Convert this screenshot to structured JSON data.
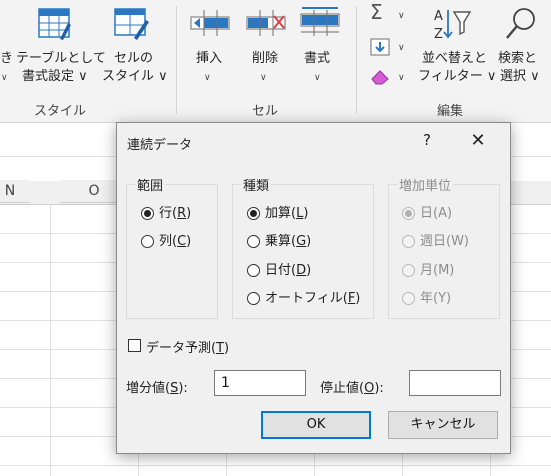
{
  "ribbon": {
    "style_group": {
      "partial_label_1": "き",
      "partial_label_2": "∨",
      "table_format_label_1": "テーブルとして",
      "table_format_label_2": "書式設定 ∨",
      "cell_style_label_1": "セルの",
      "cell_style_label_2": "スタイル ∨",
      "group_label": "スタイル"
    },
    "cells_group": {
      "insert_label": "挿入",
      "delete_label": "削除",
      "format_label": "書式",
      "chevron": "∨",
      "group_label": "セル"
    },
    "edit_group": {
      "sort_filter_label_1": "並べ替えと",
      "sort_filter_label_2": "フィルター ∨",
      "find_select_label_1": "検索と",
      "find_select_label_2": "選択 ∨",
      "group_label": "編集",
      "sigma": "Σ",
      "chevron": "∨"
    }
  },
  "sheet": {
    "columns": [
      "N",
      "O"
    ]
  },
  "dialog": {
    "title": "連続データ",
    "help": "?",
    "close": "✕",
    "range_group": {
      "title": "範囲",
      "options": [
        {
          "pre": "行(",
          "key": "R",
          "post": ")",
          "selected": true
        },
        {
          "pre": "列(",
          "key": "C",
          "post": ")",
          "selected": false
        }
      ]
    },
    "type_group": {
      "title": "種類",
      "options": [
        {
          "pre": "加算(",
          "key": "L",
          "post": ")",
          "selected": true
        },
        {
          "pre": "乗算(",
          "key": "G",
          "post": ")",
          "selected": false
        },
        {
          "pre": "日付(",
          "key": "D",
          "post": ")",
          "selected": false
        },
        {
          "pre": "オートフィル(",
          "key": "F",
          "post": ")",
          "selected": false
        }
      ]
    },
    "date_unit_group": {
      "title": "増加単位",
      "options": [
        {
          "label": "日(A)",
          "selected": true
        },
        {
          "label": "週日(W)",
          "selected": false
        },
        {
          "label": "月(M)",
          "selected": false
        },
        {
          "label": "年(Y)",
          "selected": false
        }
      ]
    },
    "trend": {
      "pre": "データ予測(",
      "key": "T",
      "post": ")",
      "checked": false
    },
    "step": {
      "pre": "増分値(",
      "key": "S",
      "post": "):",
      "value": "1"
    },
    "stop": {
      "pre": "停止値(",
      "key": "O",
      "post": "):",
      "value": ""
    },
    "ok_label": "OK",
    "cancel_label": "キャンセル"
  },
  "colors": {
    "accent": "#0078d7",
    "ribbon_bg": "#f3f3f3",
    "dialog_bg": "#f0f0f0"
  }
}
